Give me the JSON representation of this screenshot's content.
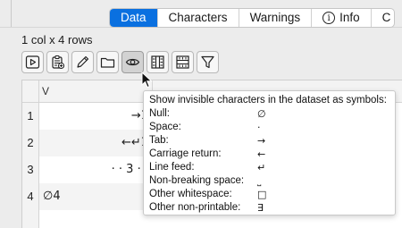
{
  "tabs": [
    {
      "label": "Data",
      "active": true
    },
    {
      "label": "Characters",
      "active": false
    },
    {
      "label": "Warnings",
      "active": false
    },
    {
      "label": "Info",
      "active": false,
      "icon": "info-icon"
    },
    {
      "label": "C",
      "active": false
    }
  ],
  "summary": "1 col x 4 rows",
  "toolbar": [
    {
      "icon": "play-icon",
      "pressed": false
    },
    {
      "icon": "clipboard-add-icon",
      "pressed": false
    },
    {
      "icon": "pencil-icon",
      "pressed": false
    },
    {
      "icon": "folder-icon",
      "pressed": false
    },
    {
      "icon": "eye-icon",
      "pressed": true
    },
    {
      "icon": "columns-icon",
      "pressed": false
    },
    {
      "icon": "rows-icon",
      "pressed": false
    },
    {
      "icon": "filter-icon",
      "pressed": false
    }
  ],
  "grid": {
    "column_header": "V",
    "rows": [
      {
        "num": "1",
        "value": "→1",
        "align": "right"
      },
      {
        "num": "2",
        "value": "←↵1",
        "align": "right"
      },
      {
        "num": "3",
        "value": "· · 3 · ·",
        "align": "right"
      },
      {
        "num": "4",
        "value": "∅4",
        "align": "left"
      }
    ]
  },
  "tooltip": {
    "title": "Show invisible characters in the dataset as symbols:",
    "items": [
      {
        "label": "Null:",
        "symbol": "∅"
      },
      {
        "label": "Space:",
        "symbol": "·"
      },
      {
        "label": "Tab:",
        "symbol": "→"
      },
      {
        "label": "Carriage return:",
        "symbol": "←"
      },
      {
        "label": "Line feed:",
        "symbol": "↵"
      },
      {
        "label": "Non-breaking space:",
        "symbol": "˽"
      },
      {
        "label": "Other whitespace:",
        "symbol": "□"
      },
      {
        "label": "Other non-printable:",
        "symbol": "∃"
      }
    ]
  },
  "colors": {
    "accent": "#0a70e0"
  }
}
